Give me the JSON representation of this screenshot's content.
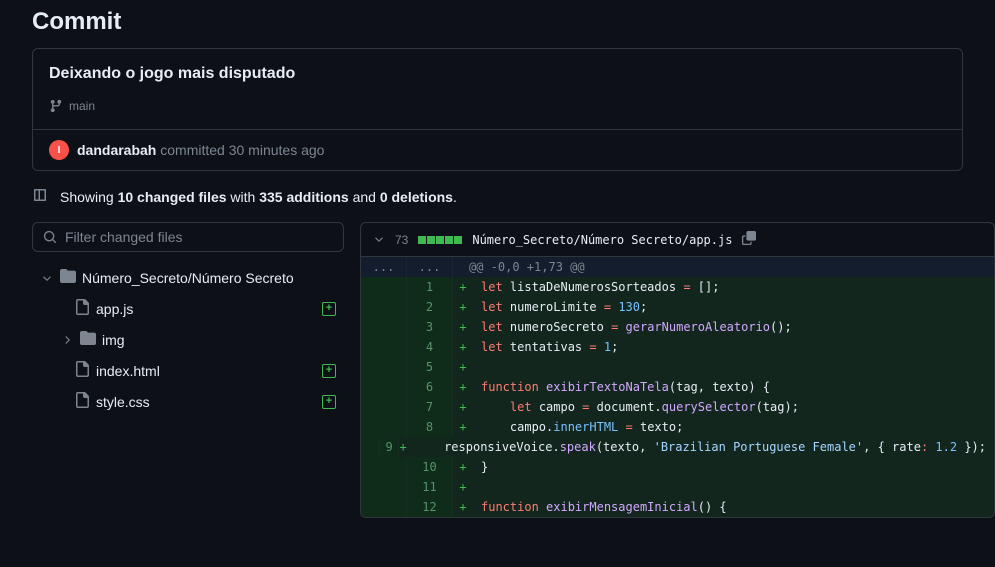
{
  "page_title": "Commit",
  "commit": {
    "title": "Deixando o jogo mais disputado",
    "branch": "main",
    "author": "dandarabah",
    "action": " committed ",
    "when": "30 minutes ago"
  },
  "summary": {
    "prefix": "Showing ",
    "files_count": "10 changed files",
    "mid1": " with ",
    "additions": "335 additions",
    "mid2": " and ",
    "deletions": "0 deletions",
    "suffix": "."
  },
  "filter": {
    "placeholder": "Filter changed files"
  },
  "tree": {
    "folder": "Número_Secreto/Número Secreto",
    "items": [
      {
        "name": "app.js",
        "kind": "file",
        "added": true
      },
      {
        "name": "img",
        "kind": "dir",
        "added": false
      },
      {
        "name": "index.html",
        "kind": "file",
        "added": true
      },
      {
        "name": "style.css",
        "kind": "file",
        "added": true
      }
    ]
  },
  "diff": {
    "count": "73",
    "path": "Número_Secreto/Número Secreto/app.js",
    "hunk": "@@ -0,0 +1,73 @@",
    "lines": [
      {
        "n": "1",
        "tokens": [
          [
            "kw",
            "let "
          ],
          [
            "id",
            "listaDeNumerosSorteados"
          ],
          [
            "id",
            " "
          ],
          [
            "op",
            "="
          ],
          [
            "id",
            " []"
          ],
          [
            "id",
            ";"
          ]
        ]
      },
      {
        "n": "2",
        "tokens": [
          [
            "kw",
            "let "
          ],
          [
            "id",
            "numeroLimite"
          ],
          [
            "id",
            " "
          ],
          [
            "op",
            "="
          ],
          [
            "id",
            " "
          ],
          [
            "num",
            "130"
          ],
          [
            "id",
            ";"
          ]
        ]
      },
      {
        "n": "3",
        "tokens": [
          [
            "kw",
            "let "
          ],
          [
            "id",
            "numeroSecreto"
          ],
          [
            "id",
            " "
          ],
          [
            "op",
            "="
          ],
          [
            "id",
            " "
          ],
          [
            "fn",
            "gerarNumeroAleatorio"
          ],
          [
            "id",
            "();"
          ]
        ]
      },
      {
        "n": "4",
        "tokens": [
          [
            "kw",
            "let "
          ],
          [
            "id",
            "tentativas"
          ],
          [
            "id",
            " "
          ],
          [
            "op",
            "="
          ],
          [
            "id",
            " "
          ],
          [
            "num",
            "1"
          ],
          [
            "id",
            ";"
          ]
        ]
      },
      {
        "n": "5",
        "tokens": []
      },
      {
        "n": "6",
        "tokens": [
          [
            "kw",
            "function "
          ],
          [
            "fn",
            "exibirTextoNaTela"
          ],
          [
            "id",
            "("
          ],
          [
            "id",
            "tag"
          ],
          [
            "id",
            ", "
          ],
          [
            "id",
            "texto"
          ],
          [
            "id",
            ") {"
          ]
        ]
      },
      {
        "n": "7",
        "tokens": [
          [
            "id",
            "    "
          ],
          [
            "kw",
            "let "
          ],
          [
            "id",
            "campo"
          ],
          [
            "id",
            " "
          ],
          [
            "op",
            "="
          ],
          [
            "id",
            " document."
          ],
          [
            "fn",
            "querySelector"
          ],
          [
            "id",
            "(tag);"
          ]
        ]
      },
      {
        "n": "8",
        "tokens": [
          [
            "id",
            "    campo."
          ],
          [
            "prop",
            "innerHTML"
          ],
          [
            "id",
            " "
          ],
          [
            "op",
            "="
          ],
          [
            "id",
            " texto;"
          ]
        ]
      },
      {
        "n": "9",
        "tokens": [
          [
            "id",
            "    responsiveVoice."
          ],
          [
            "fn",
            "speak"
          ],
          [
            "id",
            "(texto, "
          ],
          [
            "str",
            "'Brazilian Portuguese Female'"
          ],
          [
            "id",
            ", { "
          ],
          [
            "id",
            "rate"
          ],
          [
            "op",
            ":"
          ],
          [
            "id",
            " "
          ],
          [
            "num",
            "1.2"
          ],
          [
            "id",
            " });"
          ]
        ]
      },
      {
        "n": "10",
        "tokens": [
          [
            "id",
            "}"
          ]
        ]
      },
      {
        "n": "11",
        "tokens": []
      },
      {
        "n": "12",
        "tokens": [
          [
            "kw",
            "function "
          ],
          [
            "fn",
            "exibirMensagemInicial"
          ],
          [
            "id",
            "() {"
          ]
        ]
      }
    ]
  }
}
